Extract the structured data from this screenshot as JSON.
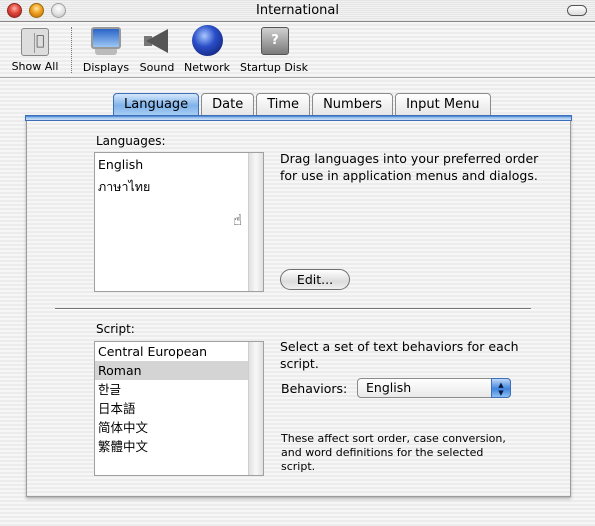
{
  "window": {
    "title": "International"
  },
  "toolbar": {
    "items": [
      {
        "label": "Show All",
        "icon": "show-all-icon"
      },
      {
        "label": "Displays",
        "icon": "displays-icon"
      },
      {
        "label": "Sound",
        "icon": "sound-icon"
      },
      {
        "label": "Network",
        "icon": "network-globe-icon"
      },
      {
        "label": "Startup Disk",
        "icon": "startup-disk-icon"
      }
    ]
  },
  "tabs": [
    {
      "label": "Language",
      "active": true
    },
    {
      "label": "Date",
      "active": false
    },
    {
      "label": "Time",
      "active": false
    },
    {
      "label": "Numbers",
      "active": false
    },
    {
      "label": "Input Menu",
      "active": false
    }
  ],
  "languages": {
    "label": "Languages:",
    "items": [
      "English",
      "ภาษาไทย"
    ],
    "description": "Drag languages into your preferred order for use in application menus and dialogs.",
    "edit_button": "Edit..."
  },
  "script": {
    "label": "Script:",
    "items": [
      "Central European",
      "Roman",
      "한글",
      "日本語",
      "简体中文",
      "繁體中文"
    ],
    "selected": "Roman",
    "description": "Select a set of text behaviors for each script.",
    "behaviors_label": "Behaviors:",
    "behaviors_value": "English",
    "note": "These affect sort order, case conversion, and word definitions for the selected script."
  },
  "colors": {
    "accent": "#3d6fb8",
    "selected_row": "#d4d4d4"
  }
}
